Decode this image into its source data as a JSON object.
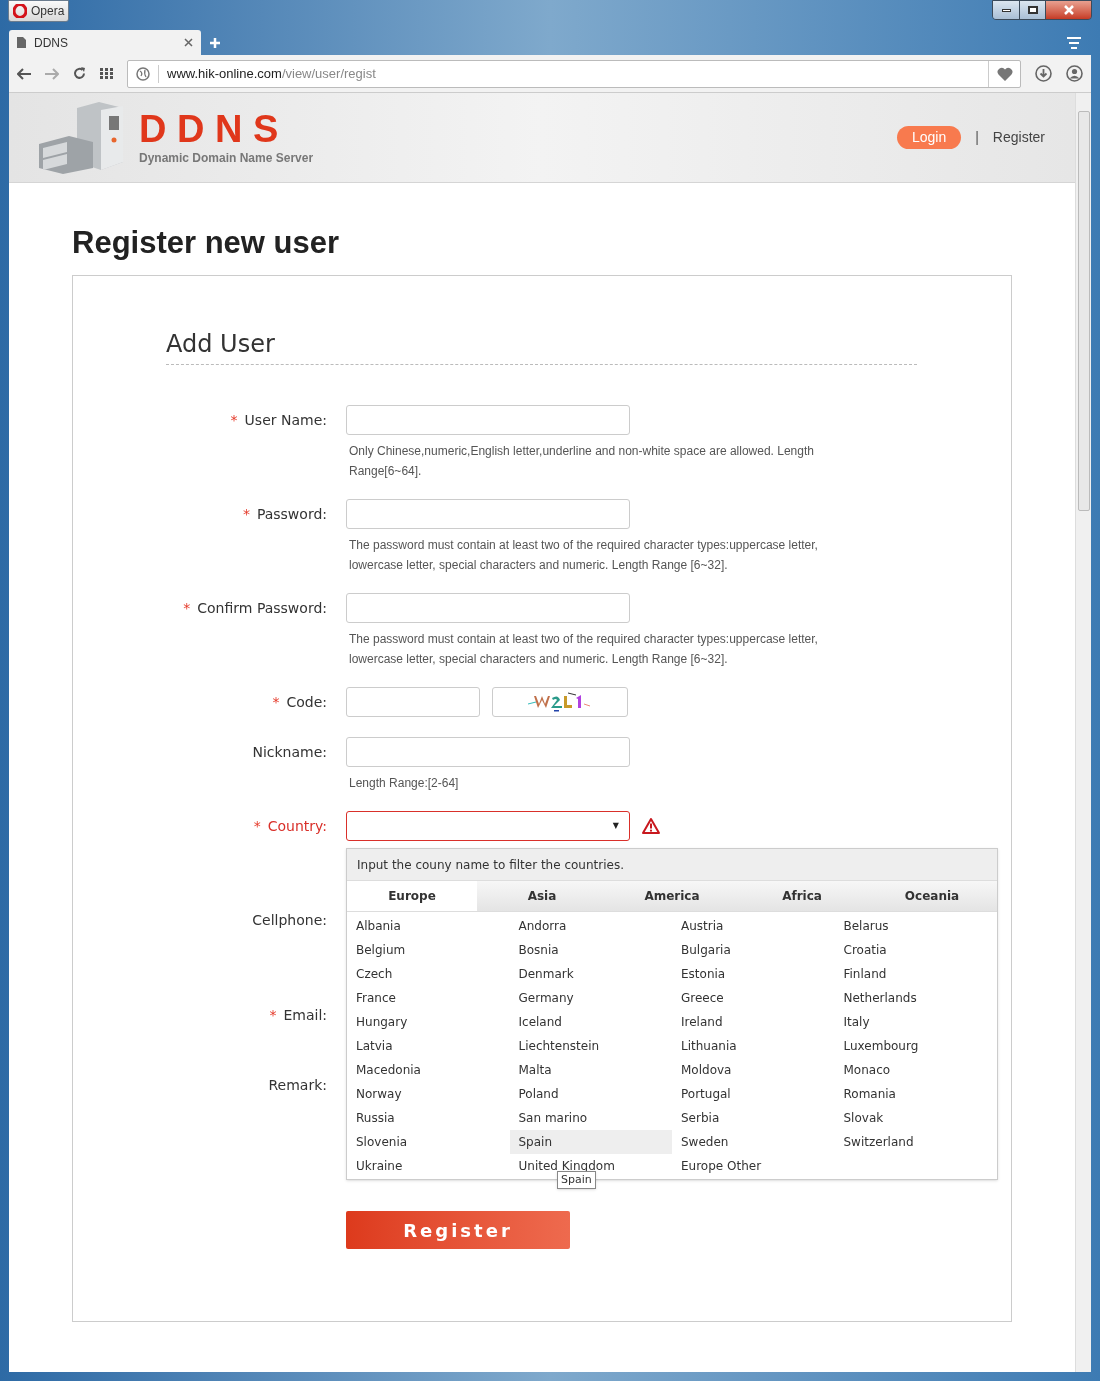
{
  "browser": {
    "menu_button": "Opera",
    "tab_title": "DDNS",
    "url_host": "www.hik-online.com",
    "url_path": "/view/user/regist"
  },
  "header": {
    "logo_title": "D D N S",
    "logo_subtitle": "Dynamic Domain Name Server",
    "login": "Login",
    "separator": "|",
    "register": "Register"
  },
  "page_title": "Register new user",
  "section_title": "Add User",
  "required_mark": "*",
  "fields": [
    {
      "label": "User Name:",
      "required": true,
      "kind": "text",
      "hint": "Only Chinese,numeric,English letter,underline and non-white space are allowed. Length Range[6~64]."
    },
    {
      "label": "Password:",
      "required": true,
      "kind": "text",
      "hint": "The password must contain at least two of the required character types:uppercase letter, lowercase letter, special characters and numeric. Length Range [6~32]."
    },
    {
      "label": "Confirm Password:",
      "required": true,
      "kind": "text",
      "hint": "The password must contain at least two of the required character types:uppercase letter, lowercase letter, special characters and numeric. Length Range [6~32]."
    },
    {
      "label": "Code:",
      "required": true,
      "kind": "code"
    },
    {
      "label": "Nickname:",
      "required": false,
      "kind": "text",
      "hint": "Length Range:[2-64]"
    },
    {
      "label": "Country:",
      "required": true,
      "kind": "select",
      "error": true,
      "arrow": "▼"
    },
    {
      "label": "Cellphone:",
      "required": false,
      "kind": "hidden"
    },
    {
      "label": "Email:",
      "required": true,
      "kind": "hidden"
    },
    {
      "label": "Remark:",
      "required": false,
      "kind": "hidden"
    }
  ],
  "country_dropdown": {
    "filter_hint": "Input the couny name to filter the countries.",
    "tabs": [
      {
        "label": "Europe",
        "selected": true
      },
      {
        "label": "Asia",
        "selected": false
      },
      {
        "label": "America",
        "selected": false
      },
      {
        "label": "Africa",
        "selected": false
      },
      {
        "label": "Oceania",
        "selected": false
      }
    ],
    "countries": [
      {
        "name": "Albania",
        "hovered": false
      },
      {
        "name": "Andorra",
        "hovered": false
      },
      {
        "name": "Austria",
        "hovered": false
      },
      {
        "name": "Belarus",
        "hovered": false
      },
      {
        "name": "Belgium",
        "hovered": false
      },
      {
        "name": "Bosnia",
        "hovered": false
      },
      {
        "name": "Bulgaria",
        "hovered": false
      },
      {
        "name": "Croatia",
        "hovered": false
      },
      {
        "name": "Czech",
        "hovered": false
      },
      {
        "name": "Denmark",
        "hovered": false
      },
      {
        "name": "Estonia",
        "hovered": false
      },
      {
        "name": "Finland",
        "hovered": false
      },
      {
        "name": "France",
        "hovered": false
      },
      {
        "name": "Germany",
        "hovered": false
      },
      {
        "name": "Greece",
        "hovered": false
      },
      {
        "name": "Netherlands",
        "hovered": false
      },
      {
        "name": "Hungary",
        "hovered": false
      },
      {
        "name": "Iceland",
        "hovered": false
      },
      {
        "name": "Ireland",
        "hovered": false
      },
      {
        "name": "Italy",
        "hovered": false
      },
      {
        "name": "Latvia",
        "hovered": false
      },
      {
        "name": "Liechtenstein",
        "hovered": false
      },
      {
        "name": "Lithuania",
        "hovered": false
      },
      {
        "name": "Luxembourg",
        "hovered": false
      },
      {
        "name": "Macedonia",
        "hovered": false
      },
      {
        "name": "Malta",
        "hovered": false
      },
      {
        "name": "Moldova",
        "hovered": false
      },
      {
        "name": "Monaco",
        "hovered": false
      },
      {
        "name": "Norway",
        "hovered": false
      },
      {
        "name": "Poland",
        "hovered": false
      },
      {
        "name": "Portugal",
        "hovered": false
      },
      {
        "name": "Romania",
        "hovered": false
      },
      {
        "name": "Russia",
        "hovered": false
      },
      {
        "name": "San marino",
        "hovered": false
      },
      {
        "name": "Serbia",
        "hovered": false
      },
      {
        "name": "Slovak",
        "hovered": false
      },
      {
        "name": "Slovenia",
        "hovered": false
      },
      {
        "name": "Spain",
        "hovered": true
      },
      {
        "name": "Sweden",
        "hovered": false
      },
      {
        "name": "Switzerland",
        "hovered": false
      },
      {
        "name": "Ukraine",
        "hovered": false
      },
      {
        "name": "United Kingdom",
        "hovered": false
      },
      {
        "name": "Europe Other",
        "hovered": false
      }
    ],
    "tooltip": "Spain"
  },
  "submit": "Register"
}
